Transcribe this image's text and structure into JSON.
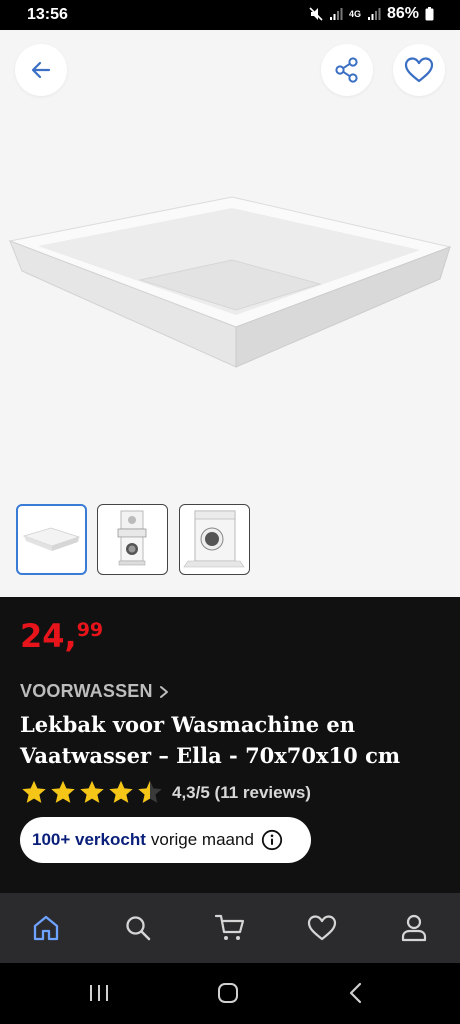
{
  "status_bar": {
    "time": "13:56",
    "network": "4G",
    "battery": "86%"
  },
  "gallery": {
    "thumbnails": [
      "drip-tray",
      "washer-stacking-kit",
      "washing-machine-on-tray"
    ],
    "selected_index": 0
  },
  "product": {
    "price_main": "24,",
    "price_cents": "99",
    "category": "VOORWASSEN",
    "title": "Lekbak voor Wasmachine en Vaatwasser – Ella - 70x70x10 cm",
    "rating_value": 4.3,
    "rating_text": "4,3/5 (11 reviews)",
    "sold_strong": "100+ verkocht",
    "sold_rest": "vorige maand"
  },
  "bottom_nav": {
    "items": [
      "home-icon",
      "search-icon",
      "cart-icon",
      "heart-icon",
      "profile-icon"
    ],
    "active_index": 0
  },
  "colors": {
    "price": "#e8141b",
    "accent": "#3a7bd5",
    "star": "#f5c518",
    "sold_text": "#0a1f7a"
  }
}
